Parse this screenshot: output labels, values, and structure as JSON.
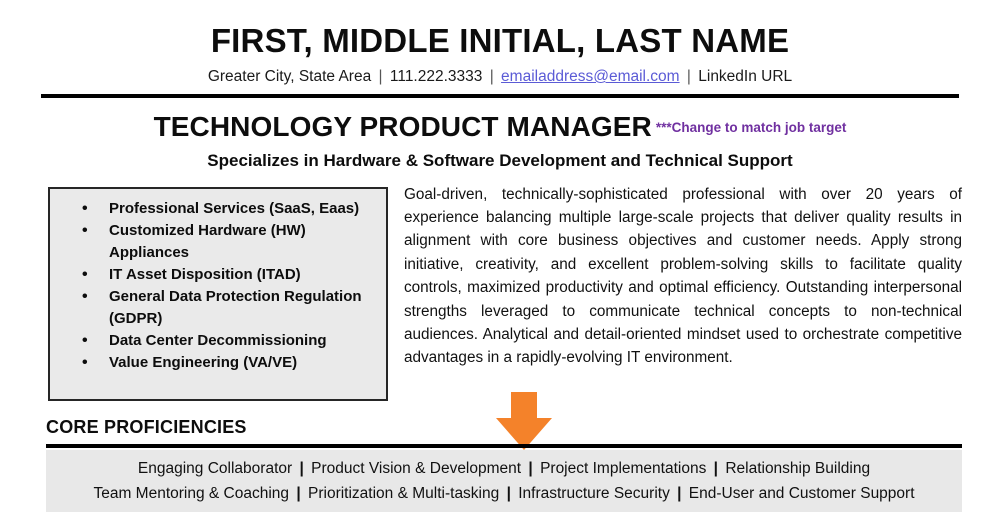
{
  "header": {
    "name": "FIRST, MIDDLE INITIAL, LAST NAME",
    "contact": {
      "location": "Greater City, State Area",
      "phone": "111.222.3333",
      "email": "emailaddress@email.com",
      "linkedin": "LinkedIn URL",
      "separator": "|"
    }
  },
  "title_block": {
    "job_title": "TECHNOLOGY PRODUCT MANAGER",
    "annotation": "***Change to match job target",
    "annotation_color": "#7030a0",
    "subtitle": "Specializes in Hardware & Software Development and Technical Support"
  },
  "skills_box": {
    "items": [
      "Professional Services (SaaS, Eaas)",
      "Customized Hardware (HW) Appliances",
      "IT Asset Disposition (ITAD)",
      "General Data Protection Regulation (GDPR)",
      "Data Center Decommissioning",
      "Value Engineering (VA/VE)"
    ],
    "fill_color": "#eaeaea",
    "border_color": "#262626"
  },
  "summary": {
    "text": "Goal-driven, technically-sophisticated professional with over 20 years of experience balancing multiple large-scale projects that deliver quality results in alignment with core business objectives and customer needs.  Apply strong initiative, creativity, and excellent problem-solving skills to facilitate quality controls, maximized productivity and optimal efficiency. Outstanding interpersonal strengths leveraged to communicate technical concepts to non-technical audiences.  Analytical and detail-oriented mindset used to orchestrate competitive advantages in a rapidly-evolving IT environment."
  },
  "arrow": {
    "direction": "down",
    "color": "#f4822a"
  },
  "core_proficiencies": {
    "heading": "CORE PROFICIENCIES",
    "box_color": "#e8e8e8",
    "separator": "|",
    "rows": [
      [
        "Engaging Collaborator",
        "Product Vision & Development",
        "Project Implementations",
        "Relationship Building"
      ],
      [
        "Team Mentoring & Coaching",
        "Prioritization & Multi-tasking",
        "Infrastructure Security",
        "End-User and Customer Support"
      ]
    ]
  }
}
